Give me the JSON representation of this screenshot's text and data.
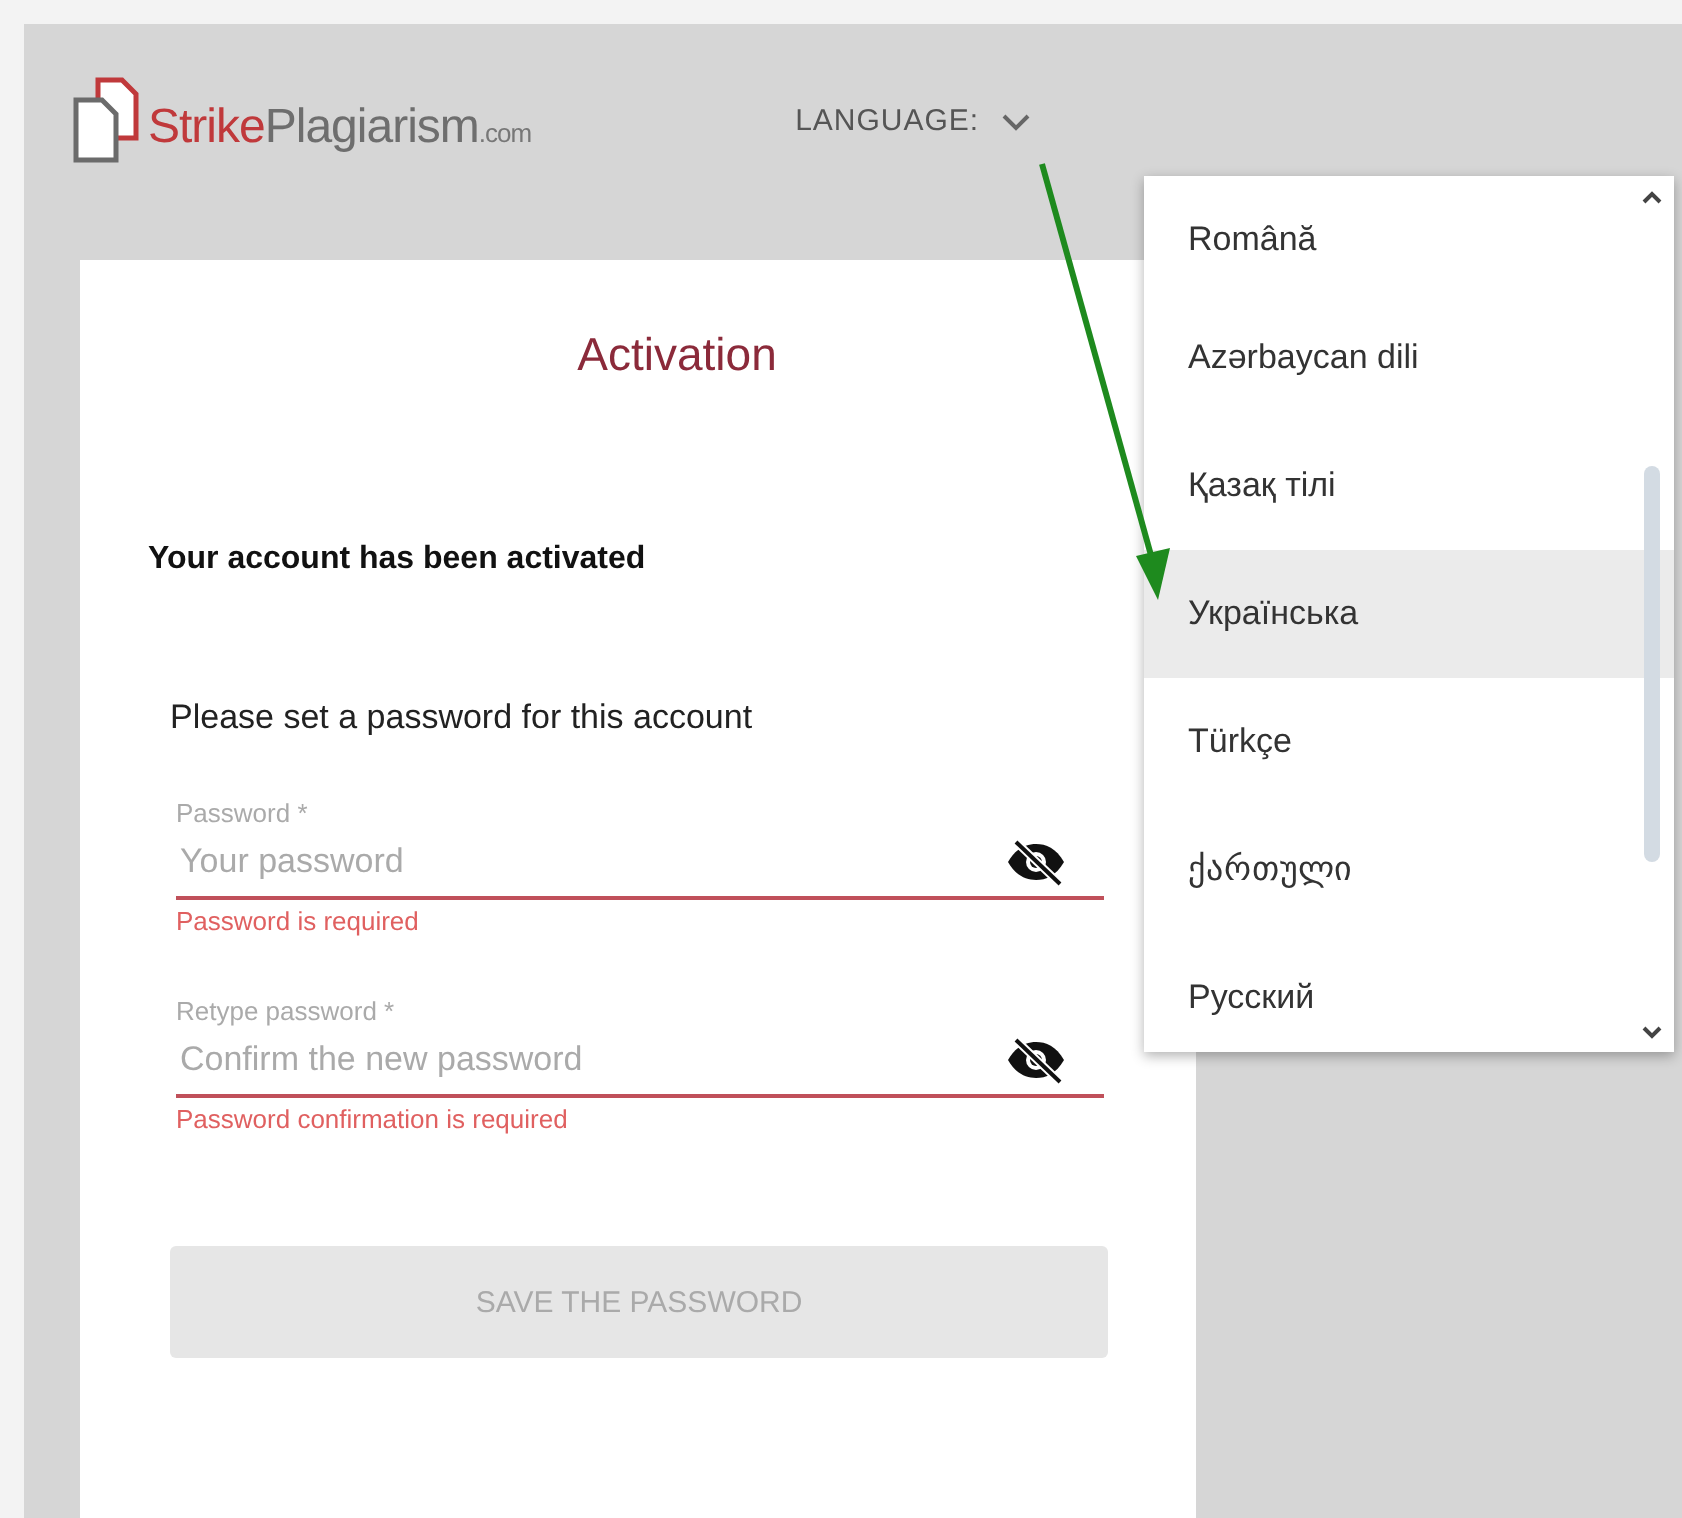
{
  "logo": {
    "brand": "Strike",
    "name": "Plagiarism",
    "suffix": ".com"
  },
  "language": {
    "label": "LANGUAGE:",
    "expanded": true,
    "options": [
      {
        "label": "Română",
        "selected": false
      },
      {
        "label": "Azərbaycan dili",
        "selected": false
      },
      {
        "label": "Қазақ тілі",
        "selected": false
      },
      {
        "label": "Українська",
        "selected": true
      },
      {
        "label": "Türkçe",
        "selected": false
      },
      {
        "label": "ქართული",
        "selected": false
      },
      {
        "label": "Русский",
        "selected": false
      }
    ]
  },
  "card": {
    "title": "Activation",
    "message": "Your account has been activated",
    "instruction": "Please set a password for this account",
    "fields": [
      {
        "label": "Password *",
        "placeholder": "Your password",
        "error": "Password is required"
      },
      {
        "label": "Retype password *",
        "placeholder": "Confirm the new password",
        "error": "Password confirmation is required"
      }
    ],
    "button": {
      "label": "SAVE THE PASSWORD",
      "disabled": true
    }
  }
}
